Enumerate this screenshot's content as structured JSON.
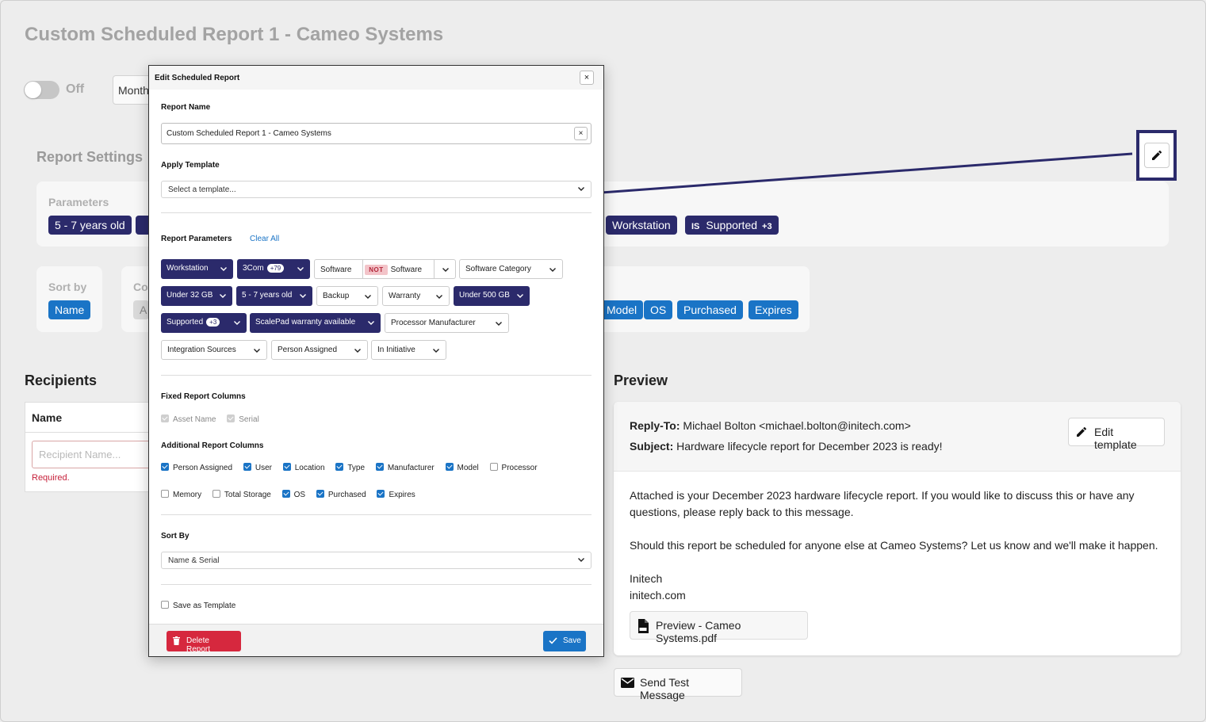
{
  "background": {
    "title": "Custom Scheduled Report 1 - Cameo Systems",
    "toggle_label": "Off",
    "frequency": "Month",
    "report_settings_heading": "Report Settings",
    "parameters_label": "Parameters",
    "parameter_pills": [
      "5 - 7 years old",
      "Workstation"
    ],
    "supported_pill": {
      "prefix": "IS",
      "label": "Supported",
      "extra": "+3"
    },
    "sort_by_label": "Sort by",
    "sort_by_value": "Name",
    "columns_label": "Co",
    "columns_value": "A",
    "column_pills": [
      "Model",
      "OS",
      "Purchased",
      "Expires"
    ]
  },
  "recipients": {
    "heading": "Recipients",
    "column_name": "Name",
    "input_placeholder": "Recipient Name...",
    "error": "Required."
  },
  "preview": {
    "heading": "Preview",
    "reply_to_label": "Reply-To:",
    "reply_to_value": "Michael Bolton <michael.bolton@initech.com>",
    "subject_label": "Subject:",
    "subject_value": "Hardware lifecycle report for December 2023 is ready!",
    "edit_template_label": "Edit template",
    "body_p1": "Attached is your December 2023 hardware lifecycle report. If you would like to discuss this or have any questions, please reply back to this message.",
    "body_p2": "Should this report be scheduled for anyone else at Cameo Systems? Let us know and we'll make it happen.",
    "signature_line1": "Initech",
    "signature_line2": "initech.com",
    "attachment_label": "Preview - Cameo Systems.pdf",
    "send_test_label": "Send Test Message"
  },
  "modal": {
    "title": "Edit Scheduled Report",
    "close_glyph": "×",
    "report_name_label": "Report Name",
    "report_name_value": "Custom Scheduled Report 1 - Cameo Systems",
    "apply_template_label": "Apply Template",
    "template_placeholder": "Select a template...",
    "report_parameters_label": "Report Parameters",
    "clear_all_label": "Clear All",
    "chips": {
      "workstation": "Workstation",
      "3com": "3Com",
      "3com_count": "+79",
      "software_left": "Software",
      "not": "NOT",
      "software_right": "Software",
      "software_category": "Software Category",
      "under32": "Under 32 GB",
      "years": "5 - 7 years old",
      "backup": "Backup",
      "warranty": "Warranty",
      "under500": "Under 500 GB",
      "supported": "Supported",
      "supported_count": "+3",
      "scalepad": "ScalePad warranty available",
      "processor_manufacturer": "Processor Manufacturer",
      "integration_sources": "Integration Sources",
      "person_assigned": "Person Assigned",
      "in_initiative": "In Initiative"
    },
    "fixed_columns_label": "Fixed Report Columns",
    "fixed_columns": [
      "Asset Name",
      "Serial"
    ],
    "additional_columns_label": "Additional Report Columns",
    "additional_row1": [
      {
        "label": "Person Assigned",
        "checked": true
      },
      {
        "label": "User",
        "checked": true
      },
      {
        "label": "Location",
        "checked": true
      },
      {
        "label": "Type",
        "checked": true
      },
      {
        "label": "Manufacturer",
        "checked": true
      },
      {
        "label": "Model",
        "checked": true
      },
      {
        "label": "Processor",
        "checked": false
      }
    ],
    "additional_row2": [
      {
        "label": "Memory",
        "checked": false
      },
      {
        "label": "Total Storage",
        "checked": false
      },
      {
        "label": "OS",
        "checked": true
      },
      {
        "label": "Purchased",
        "checked": true
      },
      {
        "label": "Expires",
        "checked": true
      }
    ],
    "sort_by_label": "Sort By",
    "sort_by_value": "Name & Serial",
    "save_as_template_label": "Save as Template",
    "delete_label": "Delete Report",
    "save_label": "Save"
  },
  "colors": {
    "dark_chip": "#2b2a6b",
    "primary": "#1a74c6",
    "danger": "#d6283e"
  },
  "icons": [
    "pencil-icon",
    "close-icon",
    "chevron-down-icon",
    "trash-icon",
    "check-icon",
    "pdf-file-icon",
    "envelope-icon"
  ]
}
